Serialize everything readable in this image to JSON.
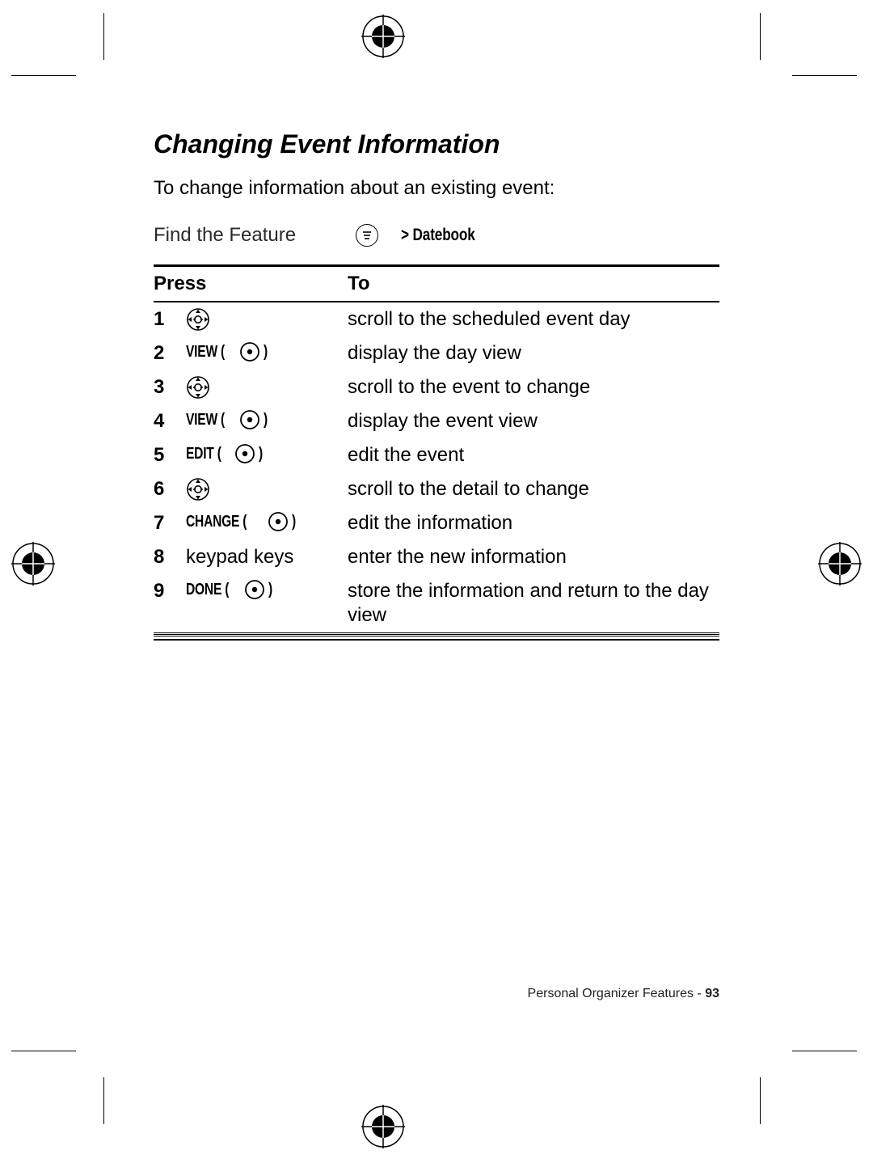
{
  "heading": "Changing Event Information",
  "intro": "To change information about an existing event:",
  "find": {
    "label": "Find the Feature",
    "path_prefix": ">",
    "path_item": "Datebook"
  },
  "table": {
    "head_press": "Press",
    "head_to": "To",
    "rows": [
      {
        "n": "1",
        "press_type": "nav",
        "to": "scroll to the scheduled event day"
      },
      {
        "n": "2",
        "press_type": "soft",
        "label": "VIEW",
        "to": "display the day view"
      },
      {
        "n": "3",
        "press_type": "nav",
        "to": "scroll to the event to change"
      },
      {
        "n": "4",
        "press_type": "soft",
        "label": "VIEW",
        "to": "display the event view"
      },
      {
        "n": "5",
        "press_type": "soft",
        "label": "EDIT",
        "to": "edit the event"
      },
      {
        "n": "6",
        "press_type": "nav",
        "to": "scroll to the detail to change"
      },
      {
        "n": "7",
        "press_type": "soft",
        "label": "CHANGE",
        "to": "edit the information"
      },
      {
        "n": "8",
        "press_type": "text",
        "label": "keypad keys",
        "to": "enter the new information"
      },
      {
        "n": "9",
        "press_type": "soft",
        "label": "DONE",
        "to": "store the information and return to the day view"
      }
    ]
  },
  "footer": {
    "section": "Personal Organizer Features",
    "sep": " - ",
    "page": "93"
  }
}
